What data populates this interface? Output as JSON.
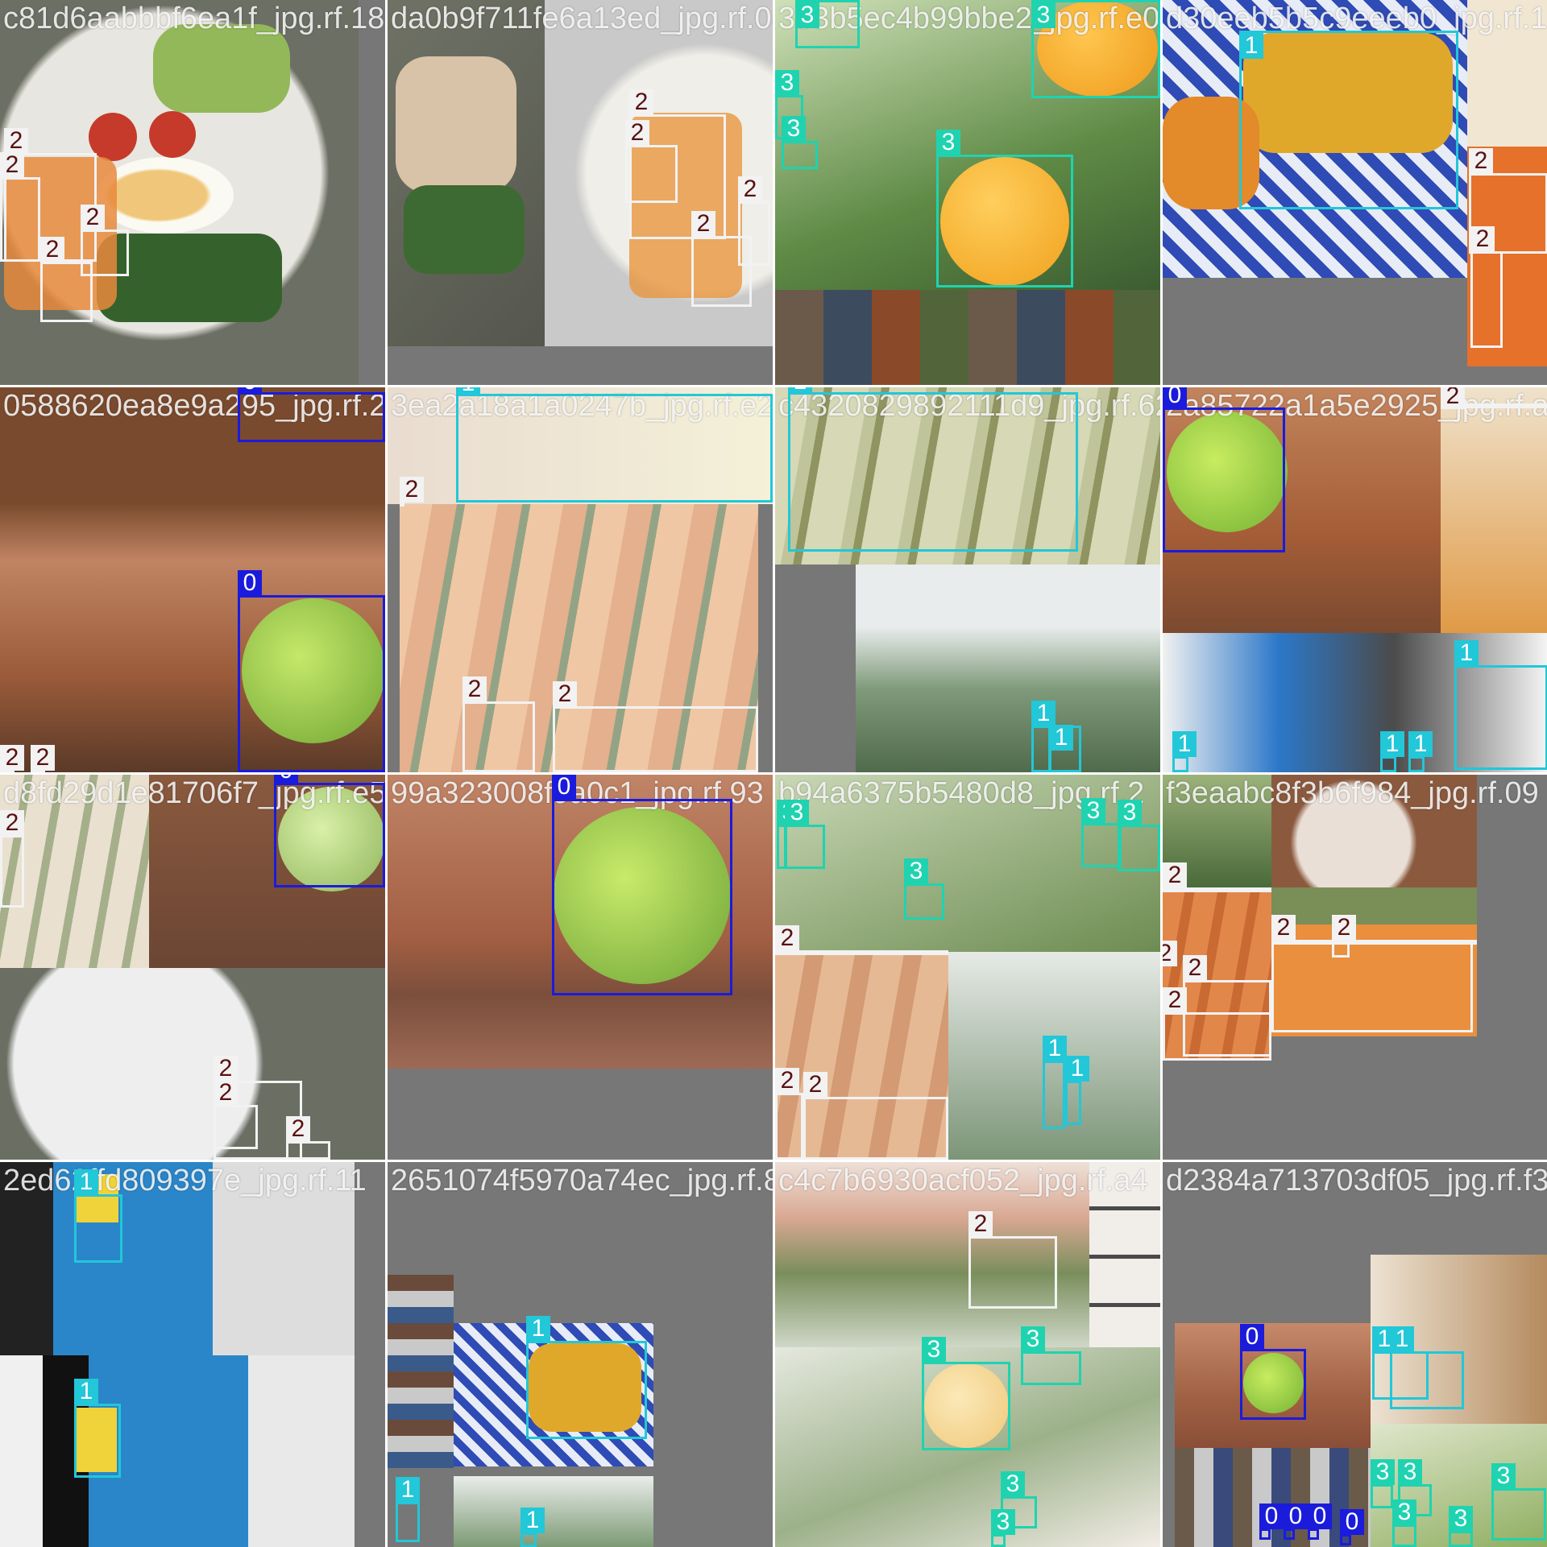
{
  "classes": {
    "0": {
      "color": "#1b1bdb"
    },
    "1": {
      "color": "#22c7d8"
    },
    "2": {
      "color": "#f2f2f2"
    },
    "3": {
      "color": "#1fd3b0"
    }
  },
  "tiles": [
    {
      "filename": "c81d6aabbbf6ea1f_jpg.rf.18",
      "labels": [
        "2",
        "2",
        "2",
        "2"
      ]
    },
    {
      "filename": "da0b9f711fe6a13ed_jpg.rf.08",
      "labels": [
        "2",
        "2",
        "2",
        "2"
      ]
    },
    {
      "filename": "353b5ec4b99bbe2_jpg.rf.e0",
      "labels": [
        "3",
        "3",
        "3",
        "3",
        "3"
      ]
    },
    {
      "filename": "d30eeb5b5c9eeeb0_jpg.rf.1",
      "labels": [
        "1",
        "2",
        "2"
      ]
    },
    {
      "filename": "0588620ea8e9a295_jpg.rf.2",
      "labels": [
        "0",
        "0",
        "2",
        "2"
      ]
    },
    {
      "filename": "3ea2a18a1a0247b_jpg.rf.e2",
      "labels": [
        "1",
        "2",
        "2",
        "2"
      ]
    },
    {
      "filename": "c4320829892111d9_jpg.rf.62",
      "labels": [
        "1",
        "1",
        "1"
      ]
    },
    {
      "filename": "2a85722a1a5e2925_jpg.rf.ae",
      "labels": [
        "0",
        "2",
        "1",
        "1",
        "1",
        "1"
      ]
    },
    {
      "filename": "d8fd29d1e81706f7_jpg.rf.e5",
      "labels": [
        "0",
        "2",
        "2",
        "2",
        "2"
      ]
    },
    {
      "filename": "99a323008f9a0c1_jpg.rf.93",
      "labels": [
        "0"
      ]
    },
    {
      "filename": "b94a6375b5480d8_jpg.rf.2",
      "labels": [
        "3",
        "3",
        "3",
        "3",
        "3",
        "2",
        "2",
        "2",
        "1",
        "1"
      ]
    },
    {
      "filename": "f3eaabc8f3b6f984_jpg.rf.09",
      "labels": [
        "2",
        "2",
        "2",
        "2",
        "2",
        "2"
      ]
    },
    {
      "filename": "2ed62ffd809397e_jpg.rf.11",
      "labels": [
        "1",
        "1"
      ]
    },
    {
      "filename": "2651074f5970a74ec_jpg.rf.88",
      "labels": [
        "1",
        "1",
        "1"
      ]
    },
    {
      "filename": "c4c7b6930acf052_jpg.rf.a4",
      "labels": [
        "2",
        "3",
        "3",
        "3",
        "3"
      ]
    },
    {
      "filename": "d2384a713703df05_jpg.rf.f35",
      "labels": [
        "0",
        "1",
        "1",
        "3",
        "3",
        "3",
        "3",
        "3",
        "0",
        "0",
        "0",
        "0"
      ]
    }
  ]
}
